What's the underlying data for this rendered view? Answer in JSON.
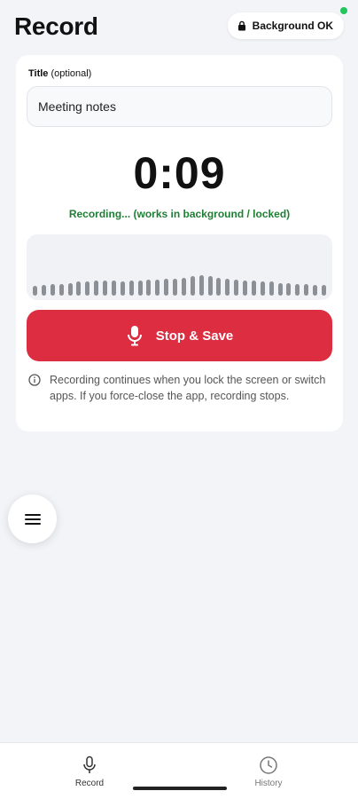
{
  "header": {
    "title": "Record",
    "background_badge": "Background OK"
  },
  "form": {
    "title_label": "Title",
    "title_optional": "(optional)",
    "title_value": "Meeting notes"
  },
  "timer": {
    "elapsed": "0:09",
    "status": "Recording... (works in background / locked)"
  },
  "waveform": {
    "levels": [
      0.45,
      0.5,
      0.55,
      0.55,
      0.6,
      0.65,
      0.65,
      0.7,
      0.7,
      0.7,
      0.65,
      0.7,
      0.7,
      0.75,
      0.75,
      0.8,
      0.8,
      0.85,
      0.9,
      0.95,
      0.9,
      0.85,
      0.8,
      0.75,
      0.7,
      0.7,
      0.65,
      0.65,
      0.6,
      0.6,
      0.55,
      0.55,
      0.5,
      0.5
    ]
  },
  "actions": {
    "stop_save_label": "Stop & Save"
  },
  "info": {
    "text": "Recording continues when you lock the screen or switch apps. If you force-close the app, recording stops."
  },
  "nav": {
    "record_label": "Record",
    "history_label": "History"
  },
  "colors": {
    "accent_red": "#dc2d41",
    "status_green": "#1e7f34"
  }
}
